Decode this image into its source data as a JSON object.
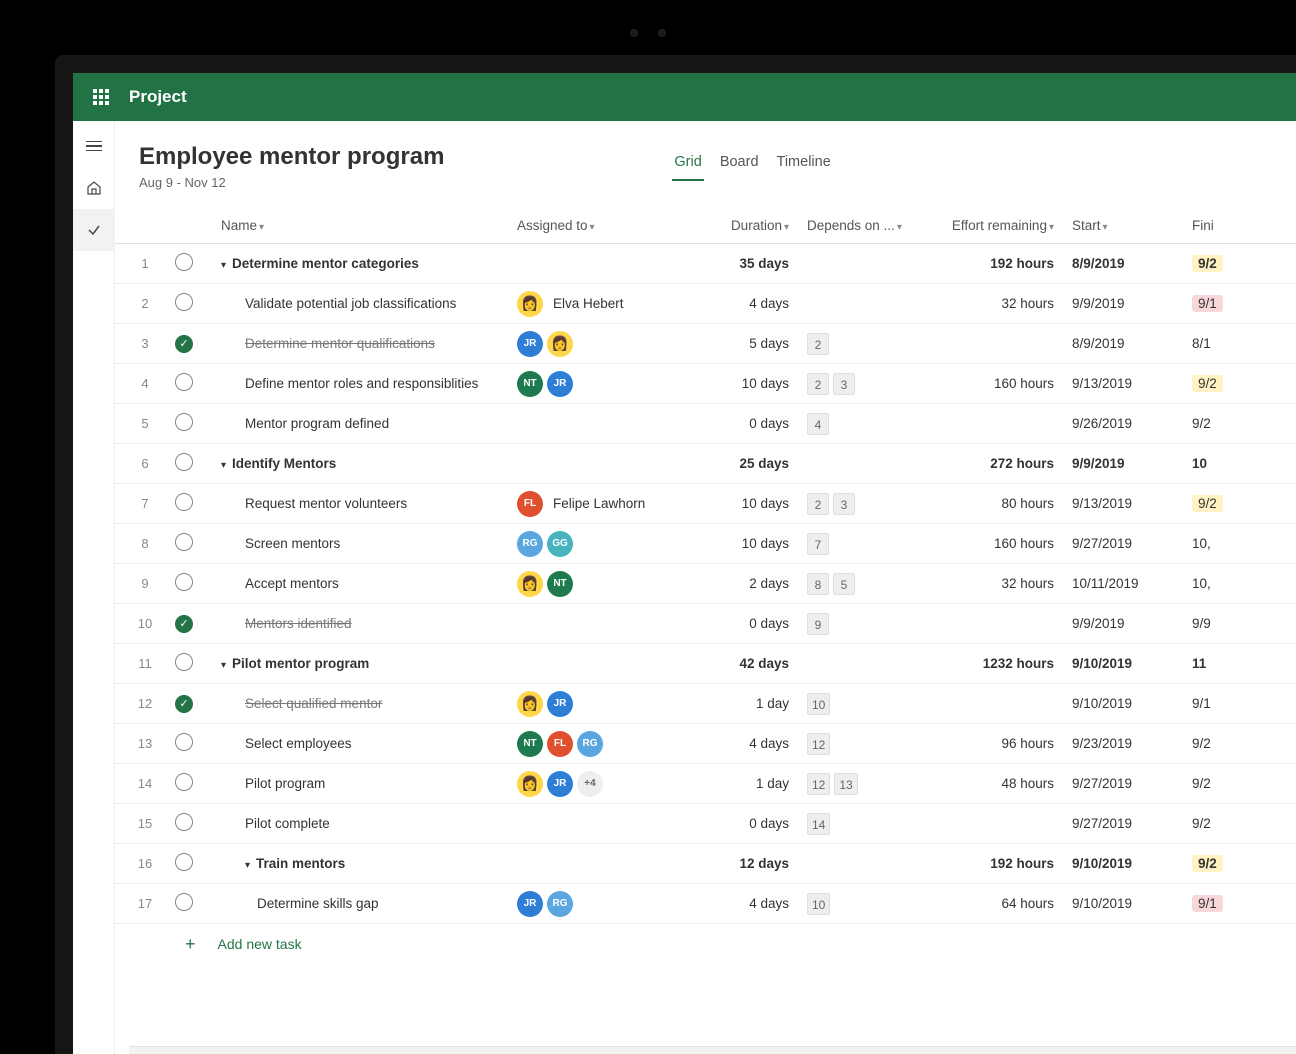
{
  "app": {
    "name": "Project"
  },
  "header": {
    "title": "Employee mentor program",
    "subtitle": "Aug 9 - Nov 12"
  },
  "tabs": [
    {
      "label": "Grid",
      "active": true
    },
    {
      "label": "Board",
      "active": false
    },
    {
      "label": "Timeline",
      "active": false
    }
  ],
  "columns": {
    "name": "Name",
    "assigned": "Assigned to",
    "duration": "Duration",
    "depends": "Depends on ...",
    "effort": "Effort remaining",
    "start": "Start",
    "finish": "Fini"
  },
  "addTask": "Add new task",
  "avatarColors": {
    "JR": "#2e7dd6",
    "NT": "#1e7b50",
    "FL": "#e0502f",
    "RG": "#5aa6e0",
    "GG": "#49b3c0"
  },
  "rows": [
    {
      "num": 1,
      "done": false,
      "level": 0,
      "name": "Determine mentor categories",
      "bold": true,
      "strike": false,
      "caret": true,
      "assigned": [],
      "assignedName": "",
      "duration": "35 days",
      "depends": [],
      "effort": "192 hours",
      "start": "8/9/2019",
      "finish": "9/2",
      "finishStyle": "yellow"
    },
    {
      "num": 2,
      "done": false,
      "level": 1,
      "name": "Validate potential job classifications",
      "bold": false,
      "strike": false,
      "caret": false,
      "assigned": [
        {
          "type": "img"
        }
      ],
      "assignedName": "Elva Hebert",
      "duration": "4 days",
      "depends": [],
      "effort": "32 hours",
      "start": "9/9/2019",
      "finish": "9/1",
      "finishStyle": "red"
    },
    {
      "num": 3,
      "done": true,
      "level": 1,
      "name": "Determine mentor qualifications",
      "bold": false,
      "strike": true,
      "caret": false,
      "assigned": [
        {
          "type": "init",
          "text": "JR",
          "color": "JR"
        },
        {
          "type": "img"
        }
      ],
      "assignedName": "",
      "duration": "5 days",
      "depends": [
        "2"
      ],
      "effort": "",
      "start": "8/9/2019",
      "finish": "8/1",
      "finishStyle": ""
    },
    {
      "num": 4,
      "done": false,
      "level": 1,
      "name": "Define mentor roles and responsiblities",
      "bold": false,
      "strike": false,
      "caret": false,
      "assigned": [
        {
          "type": "init",
          "text": "NT",
          "color": "NT"
        },
        {
          "type": "init",
          "text": "JR",
          "color": "JR"
        }
      ],
      "assignedName": "",
      "duration": "10 days",
      "depends": [
        "2",
        "3"
      ],
      "effort": "160 hours",
      "start": "9/13/2019",
      "finish": "9/2",
      "finishStyle": "yellow"
    },
    {
      "num": 5,
      "done": false,
      "level": 1,
      "name": "Mentor program defined",
      "bold": false,
      "strike": false,
      "caret": false,
      "assigned": [],
      "assignedName": "",
      "duration": "0 days",
      "depends": [
        "4"
      ],
      "effort": "",
      "start": "9/26/2019",
      "finish": "9/2",
      "finishStyle": ""
    },
    {
      "num": 6,
      "done": false,
      "level": 0,
      "name": "Identify Mentors",
      "bold": true,
      "strike": false,
      "caret": true,
      "assigned": [],
      "assignedName": "",
      "duration": "25 days",
      "depends": [],
      "effort": "272 hours",
      "start": "9/9/2019",
      "finish": "10",
      "finishStyle": ""
    },
    {
      "num": 7,
      "done": false,
      "level": 1,
      "name": "Request mentor volunteers",
      "bold": false,
      "strike": false,
      "caret": false,
      "assigned": [
        {
          "type": "init",
          "text": "FL",
          "color": "FL"
        }
      ],
      "assignedName": "Felipe Lawhorn",
      "duration": "10 days",
      "depends": [
        "2",
        "3"
      ],
      "effort": "80 hours",
      "start": "9/13/2019",
      "finish": "9/2",
      "finishStyle": "yellow"
    },
    {
      "num": 8,
      "done": false,
      "level": 1,
      "name": "Screen mentors",
      "bold": false,
      "strike": false,
      "caret": false,
      "assigned": [
        {
          "type": "init",
          "text": "RG",
          "color": "RG"
        },
        {
          "type": "init",
          "text": "GG",
          "color": "GG"
        }
      ],
      "assignedName": "",
      "duration": "10 days",
      "depends": [
        "7"
      ],
      "effort": "160 hours",
      "start": "9/27/2019",
      "finish": "10,",
      "finishStyle": ""
    },
    {
      "num": 9,
      "done": false,
      "level": 1,
      "name": "Accept mentors",
      "bold": false,
      "strike": false,
      "caret": false,
      "assigned": [
        {
          "type": "img"
        },
        {
          "type": "init",
          "text": "NT",
          "color": "NT"
        }
      ],
      "assignedName": "",
      "duration": "2 days",
      "depends": [
        "8",
        "5"
      ],
      "effort": "32 hours",
      "start": "10/11/2019",
      "finish": "10,",
      "finishStyle": ""
    },
    {
      "num": 10,
      "done": true,
      "level": 1,
      "name": "Mentors identified",
      "bold": false,
      "strike": true,
      "caret": false,
      "assigned": [],
      "assignedName": "",
      "duration": "0 days",
      "depends": [
        "9"
      ],
      "effort": "",
      "start": "9/9/2019",
      "finish": "9/9",
      "finishStyle": ""
    },
    {
      "num": 11,
      "done": false,
      "level": 0,
      "name": "Pilot mentor program",
      "bold": true,
      "strike": false,
      "caret": true,
      "assigned": [],
      "assignedName": "",
      "duration": "42 days",
      "depends": [],
      "effort": "1232 hours",
      "start": "9/10/2019",
      "finish": "11",
      "finishStyle": ""
    },
    {
      "num": 12,
      "done": true,
      "level": 1,
      "name": "Select qualified mentor",
      "bold": false,
      "strike": true,
      "caret": false,
      "assigned": [
        {
          "type": "img"
        },
        {
          "type": "init",
          "text": "JR",
          "color": "JR"
        }
      ],
      "assignedName": "",
      "duration": "1 day",
      "depends": [
        "10"
      ],
      "effort": "",
      "start": "9/10/2019",
      "finish": "9/1",
      "finishStyle": ""
    },
    {
      "num": 13,
      "done": false,
      "level": 1,
      "name": "Select employees",
      "bold": false,
      "strike": false,
      "caret": false,
      "assigned": [
        {
          "type": "init",
          "text": "NT",
          "color": "NT"
        },
        {
          "type": "init",
          "text": "FL",
          "color": "FL"
        },
        {
          "type": "init",
          "text": "RG",
          "color": "RG"
        }
      ],
      "assignedName": "",
      "duration": "4 days",
      "depends": [
        "12"
      ],
      "effort": "96 hours",
      "start": "9/23/2019",
      "finish": "9/2",
      "finishStyle": ""
    },
    {
      "num": 14,
      "done": false,
      "level": 1,
      "name": "Pilot program",
      "bold": false,
      "strike": false,
      "caret": false,
      "assigned": [
        {
          "type": "img"
        },
        {
          "type": "init",
          "text": "JR",
          "color": "JR"
        },
        {
          "type": "extra",
          "text": "+4"
        }
      ],
      "assignedName": "",
      "duration": "1 day",
      "depends": [
        "12",
        "13"
      ],
      "effort": "48 hours",
      "start": "9/27/2019",
      "finish": "9/2",
      "finishStyle": ""
    },
    {
      "num": 15,
      "done": false,
      "level": 1,
      "name": "Pilot complete",
      "bold": false,
      "strike": false,
      "caret": false,
      "assigned": [],
      "assignedName": "",
      "duration": "0 days",
      "depends": [
        "14"
      ],
      "effort": "",
      "start": "9/27/2019",
      "finish": "9/2",
      "finishStyle": ""
    },
    {
      "num": 16,
      "done": false,
      "level": 1,
      "name": "Train mentors",
      "bold": true,
      "strike": false,
      "caret": true,
      "assigned": [],
      "assignedName": "",
      "duration": "12 days",
      "depends": [],
      "effort": "192 hours",
      "start": "9/10/2019",
      "finish": "9/2",
      "finishStyle": "yellow"
    },
    {
      "num": 17,
      "done": false,
      "level": 2,
      "name": "Determine skills gap",
      "bold": false,
      "strike": false,
      "caret": false,
      "assigned": [
        {
          "type": "init",
          "text": "JR",
          "color": "JR"
        },
        {
          "type": "init",
          "text": "RG",
          "color": "RG"
        }
      ],
      "assignedName": "",
      "duration": "4 days",
      "depends": [
        "10"
      ],
      "effort": "64 hours",
      "start": "9/10/2019",
      "finish": "9/1",
      "finishStyle": "red"
    }
  ]
}
